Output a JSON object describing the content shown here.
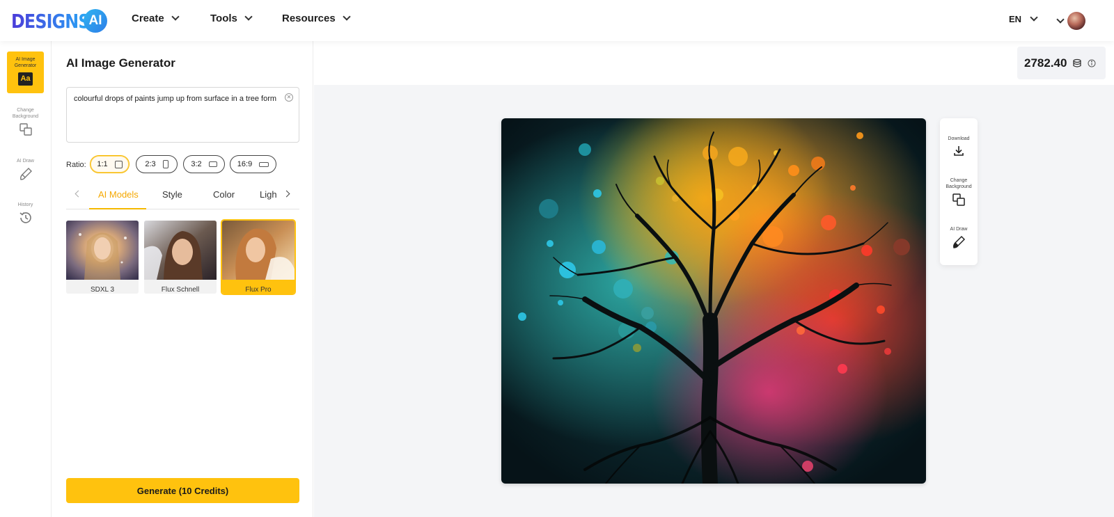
{
  "brand": {
    "logo_text": "DESIGNS.",
    "logo_badge": "AI"
  },
  "nav": {
    "items": [
      {
        "label": "Create"
      },
      {
        "label": "Tools"
      },
      {
        "label": "Resources"
      }
    ],
    "language": "EN"
  },
  "rail": {
    "items": [
      {
        "label": "AI Image Generator",
        "icon": "text-aa-icon",
        "active": true
      },
      {
        "label": "Change Background",
        "icon": "layers-swap-icon"
      },
      {
        "label": "AI Draw",
        "icon": "brush-icon"
      },
      {
        "label": "History",
        "icon": "history-icon"
      }
    ]
  },
  "panel": {
    "title": "AI Image Generator",
    "prompt": "colourful drops of paints jump up from surface in a tree form",
    "ratio_label": "Ratio:",
    "ratios": [
      {
        "label": "1:1",
        "selected": true
      },
      {
        "label": "2:3"
      },
      {
        "label": "3:2"
      },
      {
        "label": "16:9"
      }
    ],
    "tabs": [
      {
        "label": "AI Models",
        "active": true
      },
      {
        "label": "Style"
      },
      {
        "label": "Color"
      },
      {
        "label": "Ligh"
      }
    ],
    "models": [
      {
        "label": "SDXL 3"
      },
      {
        "label": "Flux Schnell"
      },
      {
        "label": "Flux Pro",
        "selected": true
      }
    ],
    "generate_label": "Generate (10 Credits)"
  },
  "canvas": {
    "credits": "2782.40",
    "actions": [
      {
        "label": "Download",
        "icon": "download-icon"
      },
      {
        "label": "Change Background",
        "icon": "layers-swap-icon"
      },
      {
        "label": "AI Draw",
        "icon": "brush-icon"
      }
    ]
  },
  "colors": {
    "accent": "#ffc20e",
    "canvas_bg": "#f4f5f7"
  }
}
